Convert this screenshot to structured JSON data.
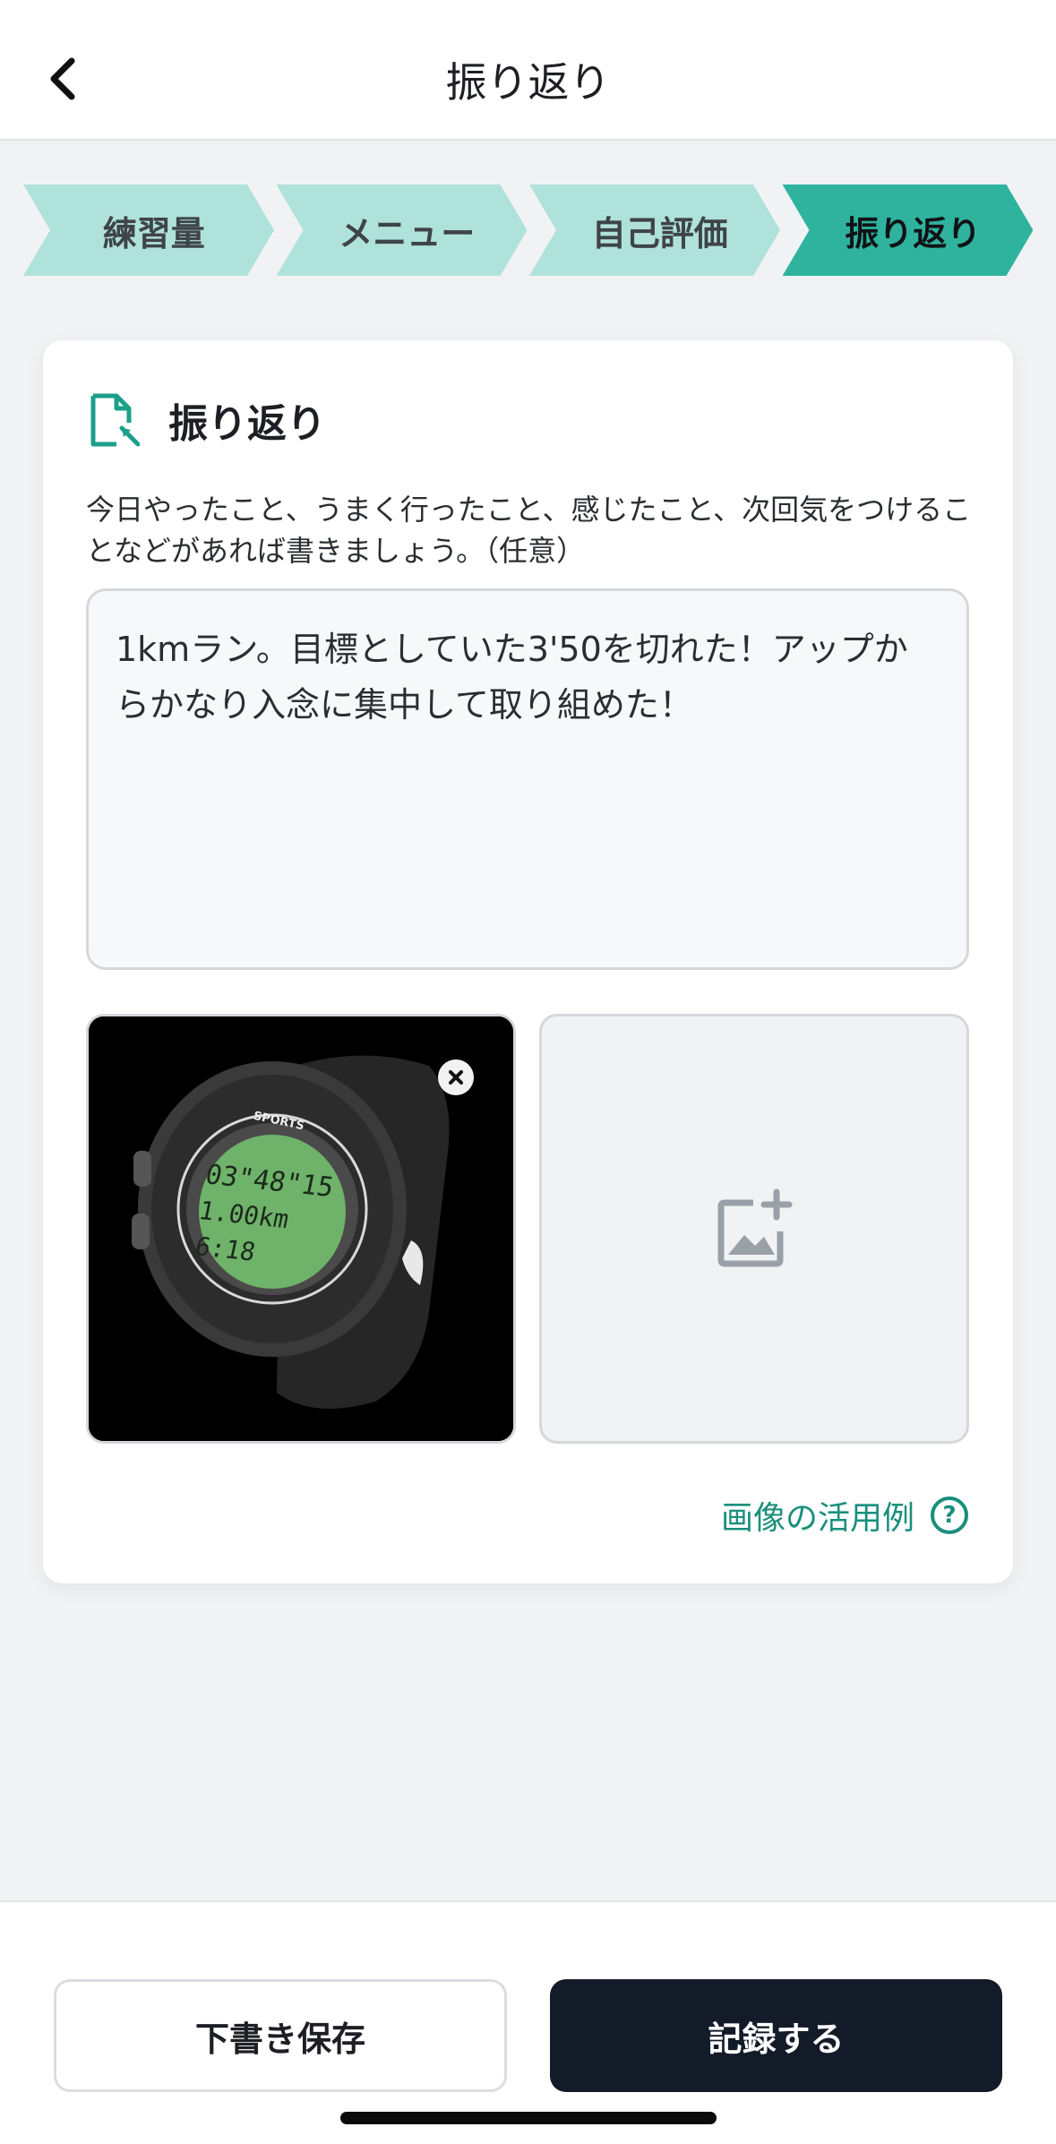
{
  "header": {
    "title": "振り返り",
    "back_icon": "chevron-left-icon"
  },
  "stepper": {
    "steps": [
      {
        "label": "練習量",
        "active": false
      },
      {
        "label": "メニュー",
        "active": false
      },
      {
        "label": "自己評価",
        "active": false
      },
      {
        "label": "振り返り",
        "active": true
      }
    ]
  },
  "card": {
    "title": "振り返り",
    "icon": "document-edit-icon",
    "description": "今日やったこと、うまく行ったこと、感じたこと、次回気をつけることなどがあれば書きましょう。（任意）",
    "textarea_value": "1kmラン。目標としていた3'50を切れた！アップからかなり入念に集中して取り組めた！",
    "photo": {
      "watch_brand": "SPORTS",
      "display_lines": [
        "03\"48\"15",
        "1.00km",
        "6:18"
      ]
    },
    "add_photo_icon": "add-image-icon",
    "examples_link": "画像の活用例",
    "help_icon_glyph": "?"
  },
  "footer": {
    "draft_label": "下書き保存",
    "record_label": "記録する"
  },
  "colors": {
    "accent": "#2fb39e",
    "accent_light": "#afe2da",
    "link": "#198f7c",
    "primary_button": "#131a28"
  }
}
